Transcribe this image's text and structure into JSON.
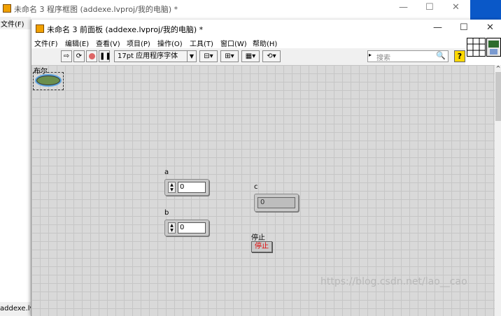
{
  "block_diagram_window": {
    "title": "未命名 3 程序框图 (addexe.lvproj/我的电脑) *",
    "menu_file": "文件(F)",
    "status_text": "addexe.lv"
  },
  "front_panel": {
    "title": "未命名 3 前面板 (addexe.lvproj/我的电脑) *",
    "menu": [
      "文件(F)",
      "编辑(E)",
      "查看(V)",
      "项目(P)",
      "操作(O)",
      "工具(T)",
      "窗口(W)",
      "帮助(H)"
    ],
    "toolbar": {
      "font": "17pt 应用程序字体",
      "search_placeholder": "搜索",
      "help": "?"
    },
    "window_controls": {
      "minimize": "—",
      "maximize": "☐",
      "close": "✕"
    },
    "controls": {
      "boolean_label": "布尔",
      "a_label": "a",
      "a_value": "0",
      "b_label": "b",
      "b_value": "0",
      "c_label": "c",
      "c_value": "0",
      "stop_label": "停止",
      "stop_button_text": "停止"
    }
  },
  "watermark": "https://blog.csdn.net/lao__cao",
  "colors": {
    "accent": "#0a58c8",
    "stop_text": "#e00000",
    "help_button": "#ffd800"
  }
}
